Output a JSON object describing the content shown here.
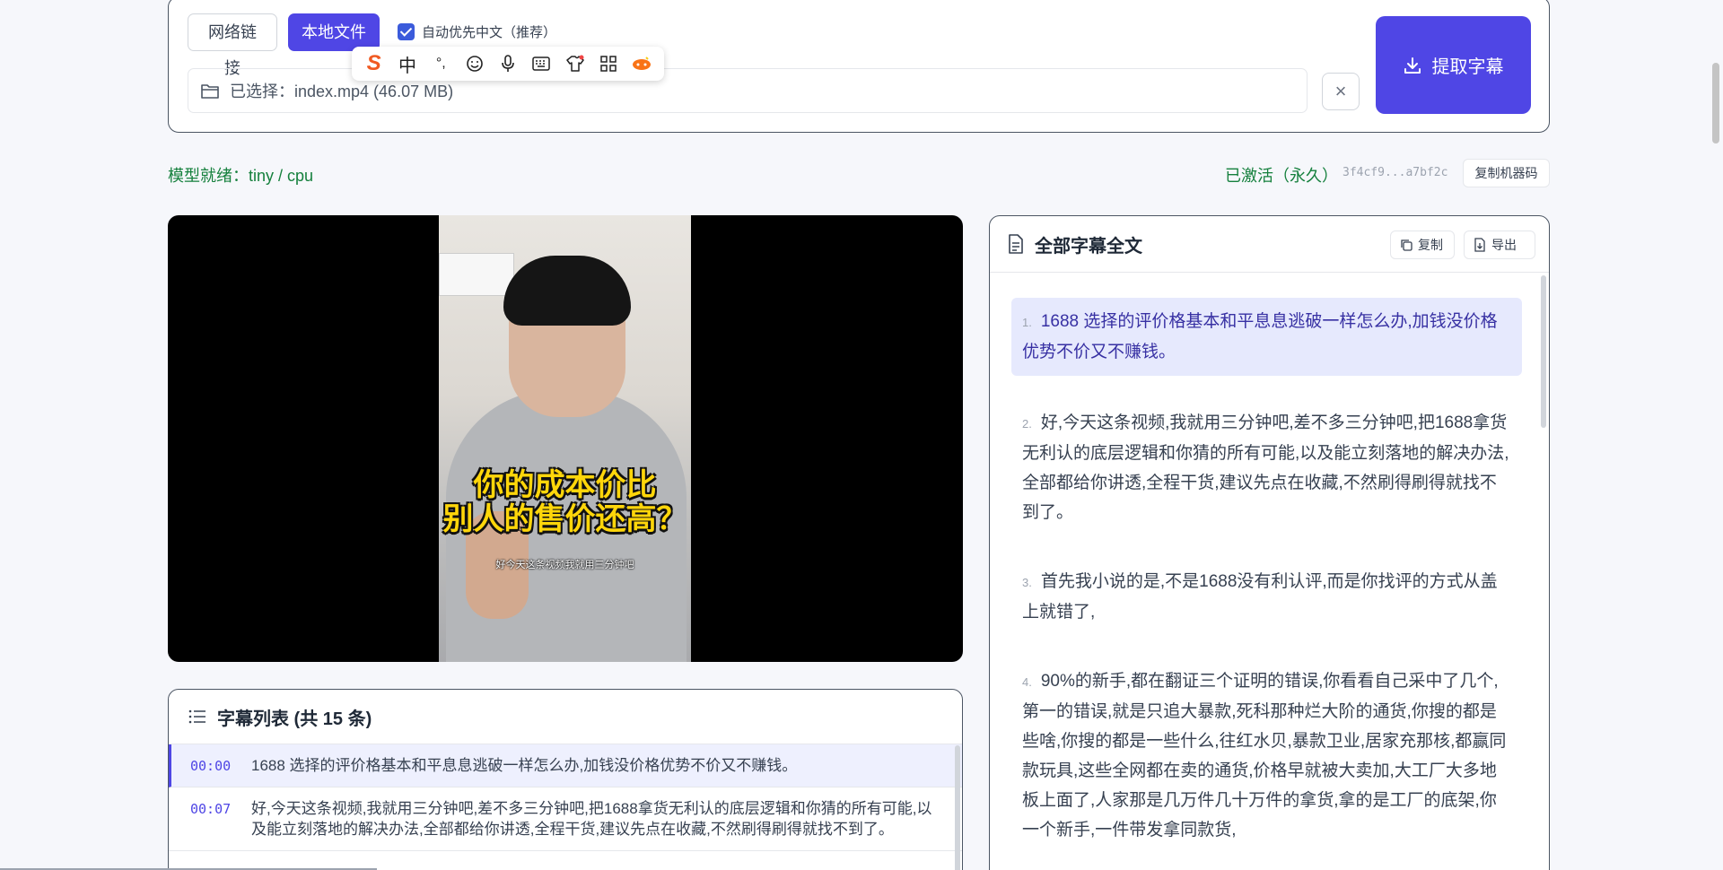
{
  "top": {
    "tab_network": "网络链接",
    "tab_local": "本地文件",
    "auto_chinese_label": "自动优先中文（推荐）",
    "auto_chinese_checked": true,
    "file_selected": "已选择：index.mp4 (46.07 MB)",
    "clear_icon": "×",
    "extract_label": "提取字幕"
  },
  "ime": {
    "logo": "S",
    "mode": "中",
    "punct": "°,",
    "icons": [
      "emoji-icon",
      "mic-icon",
      "keyboard-icon",
      "skin-icon",
      "grid-icon",
      "game-icon"
    ]
  },
  "status": {
    "model": "模型就绪：tiny / cpu",
    "activation": "已激活（永久）",
    "machine_code": "3f4cf9...a7bf2c",
    "copy_code": "复制机器码"
  },
  "video": {
    "caption_big_1": "你的成本价比",
    "caption_big_2": "别人的售价还高？",
    "caption_small": "好今天这条视频我就用三分钟吧"
  },
  "list": {
    "title": "字幕列表 (共 15 条)",
    "rows": [
      {
        "time": "00:00",
        "text": "1688 选择的评价格基本和平息息逃破一样怎么办,加钱没价格优势不价又不赚钱。"
      },
      {
        "time": "00:07",
        "text": "好,今天这条视频,我就用三分钟吧,差不多三分钟吧,把1688拿货无利认的底层逻辑和你猜的所有可能,以及能立刻落地的解决办法,全部都给你讲透,全程干货,建议先点在收藏,不然刷得刷得就找不到了。"
      }
    ]
  },
  "full": {
    "title": "全部字幕全文",
    "copy": "复制",
    "export": "导出",
    "paras": [
      {
        "num": "1.",
        "text": "1688 选择的评价格基本和平息息逃破一样怎么办,加钱没价格优势不价又不赚钱。"
      },
      {
        "num": "2.",
        "text": "好,今天这条视频,我就用三分钟吧,差不多三分钟吧,把1688拿货无利认的底层逻辑和你猜的所有可能,以及能立刻落地的解决办法,全部都给你讲透,全程干货,建议先点在收藏,不然刷得刷得就找不到了。"
      },
      {
        "num": "3.",
        "text": "首先我小说的是,不是1688没有利认评,而是你找评的方式从盖上就错了,"
      },
      {
        "num": "4.",
        "text": "90%的新手,都在翻证三个证明的错误,你看看自己采中了几个,第一的错误,就是只追大暴款,死科那种烂大阶的通货,你搜的都是些啥,你搜的都是一些什么,往红水贝,暴款卫业,居家充那核,都赢同款玩具,这些全网都在卖的通货,价格早就被大卖加,大工厂大多地板上面了,人家那是几万件几十万件的拿货,拿的是工厂的底架,你一个新手,一件带发拿同款货,"
      }
    ]
  }
}
